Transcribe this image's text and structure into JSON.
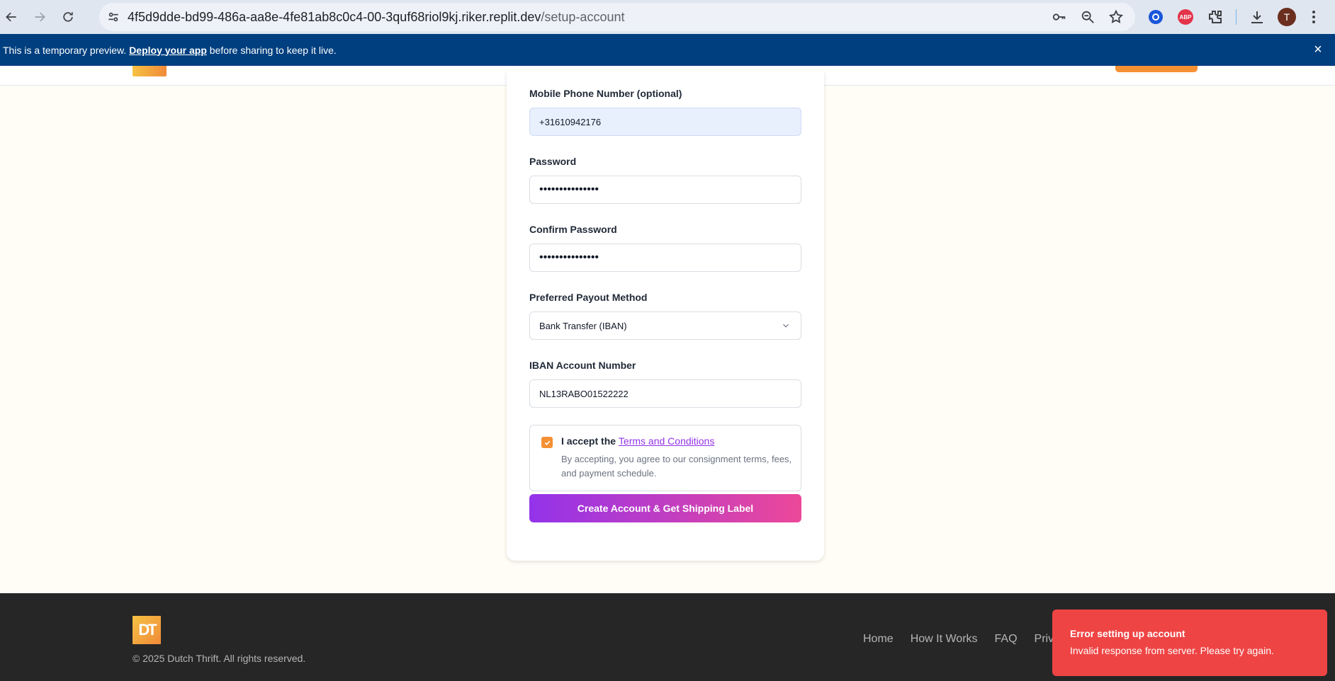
{
  "browser": {
    "url_host": "4f5d9dde-bd99-486a-aa8e-4fe81ab8c0c4-00-3quf68riol9kj.riker.replit.dev",
    "url_path": "/setup-account",
    "profile_initial": "T",
    "adblock_label": "ABP"
  },
  "banner": {
    "text_before": "This is a temporary preview. ",
    "link_text": "Deploy your app",
    "text_after": " before sharing to keep it live.",
    "close_glyph": "×"
  },
  "form": {
    "phone": {
      "label": "Mobile Phone Number (optional)",
      "value": "+31610942176"
    },
    "password": {
      "label": "Password",
      "value": "•••••••••••••••"
    },
    "confirm_password": {
      "label": "Confirm Password",
      "value": "•••••••••••••••"
    },
    "payout": {
      "label": "Preferred Payout Method",
      "value": "Bank Transfer (IBAN)"
    },
    "iban": {
      "label": "IBAN Account Number",
      "value": "NL13RABO01522222"
    },
    "terms": {
      "checked": true,
      "prefix": "I accept the ",
      "link": "Terms and Conditions",
      "description": "By accepting, you agree to our consignment terms, fees, and payment schedule."
    },
    "submit_label": "Create Account & Get Shipping Label"
  },
  "footer": {
    "logo_text": "DT",
    "copyright": "© 2025 Dutch Thrift. All rights reserved.",
    "nav": [
      "Home",
      "How It Works",
      "FAQ",
      "Priv"
    ]
  },
  "toast": {
    "title": "Error setting up account",
    "description": "Invalid response from server. Please try again."
  },
  "colors": {
    "accent_orange": "#f59033",
    "gradient_start": "#9333ea",
    "gradient_end": "#ec4899",
    "error_red": "#ef4444",
    "banner_blue": "#003f7f"
  }
}
